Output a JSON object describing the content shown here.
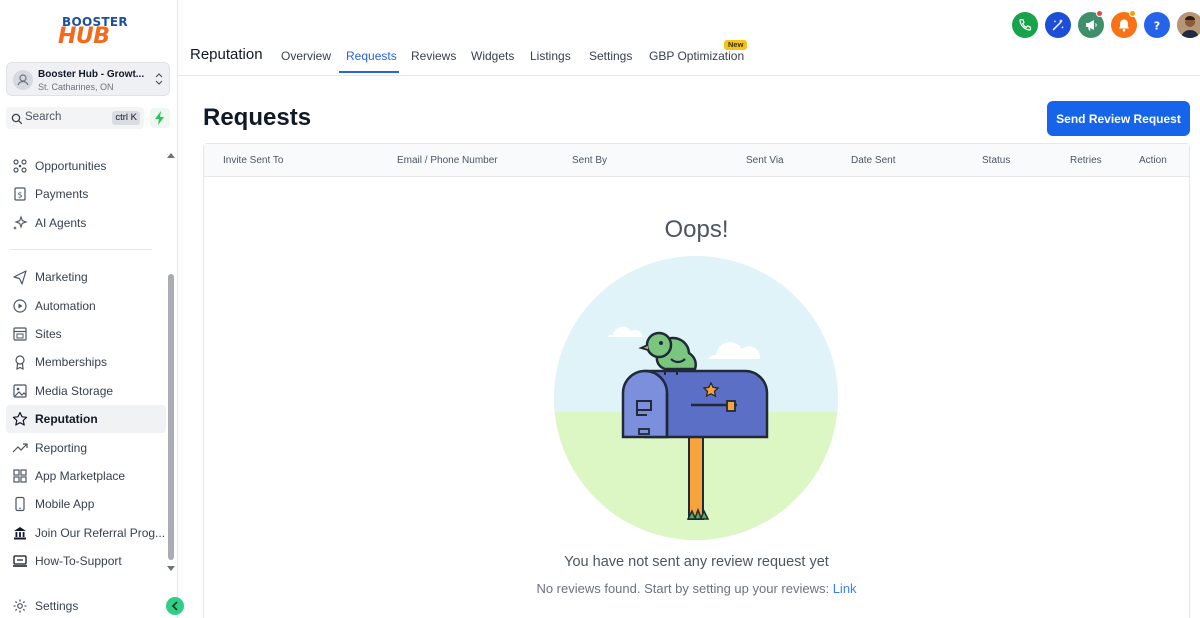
{
  "brand": {
    "line1": "BOOSTER",
    "line2": "HUB"
  },
  "location": {
    "name": "Booster Hub - Growt...",
    "address": "St. Catharines, ON"
  },
  "search": {
    "placeholder": "Search",
    "shortcut": "ctrl K"
  },
  "sidebar": {
    "items": [
      {
        "label": "Opportunities",
        "icon": "opportunities-icon"
      },
      {
        "label": "Payments",
        "icon": "payments-icon"
      },
      {
        "label": "AI Agents",
        "icon": "ai-sparkle-icon"
      },
      {
        "label": "Marketing",
        "icon": "send-icon"
      },
      {
        "label": "Automation",
        "icon": "automation-icon"
      },
      {
        "label": "Sites",
        "icon": "sites-icon"
      },
      {
        "label": "Memberships",
        "icon": "memberships-icon"
      },
      {
        "label": "Media Storage",
        "icon": "image-icon"
      },
      {
        "label": "Reputation",
        "icon": "star-icon",
        "active": true
      },
      {
        "label": "Reporting",
        "icon": "trending-icon"
      },
      {
        "label": "App Marketplace",
        "icon": "grid-icon"
      },
      {
        "label": "Mobile App",
        "icon": "mobile-icon"
      },
      {
        "label": "Join Our Referral Prog...",
        "icon": "bank-icon"
      },
      {
        "label": "How-To-Support",
        "icon": "support-icon"
      }
    ],
    "settings_label": "Settings"
  },
  "header": {
    "module_title": "Reputation",
    "tabs": [
      {
        "label": "Overview"
      },
      {
        "label": "Requests",
        "active": true
      },
      {
        "label": "Reviews"
      },
      {
        "label": "Widgets"
      },
      {
        "label": "Listings"
      },
      {
        "label": "Settings"
      },
      {
        "label": "GBP Optimization",
        "badge": "New"
      }
    ],
    "action_icons": [
      "phone-icon",
      "ai-wand-icon",
      "megaphone-icon",
      "bell-icon",
      "help-icon",
      "user-avatar"
    ]
  },
  "main": {
    "page_title": "Requests",
    "primary_button": "Send Review Request",
    "columns": [
      "Invite Sent To",
      "Email / Phone Number",
      "Sent By",
      "Sent Via",
      "Date Sent",
      "Status",
      "Retries",
      "Action"
    ],
    "empty_state": {
      "heading": "Oops!",
      "title": "You have not sent any review request yet",
      "subtitle": "No reviews found. Start by setting up your reviews:",
      "link_text": "Link"
    }
  },
  "colors": {
    "primary": "#1664ea",
    "tab_active": "#2563eb",
    "phone": "#16a34a",
    "wand": "#1d4ed8",
    "megaphone": "#3f8f6b",
    "bell": "#f97316",
    "help": "#2563eb",
    "mailbox": "#5b6fc7",
    "bird": "#7bc67f"
  }
}
